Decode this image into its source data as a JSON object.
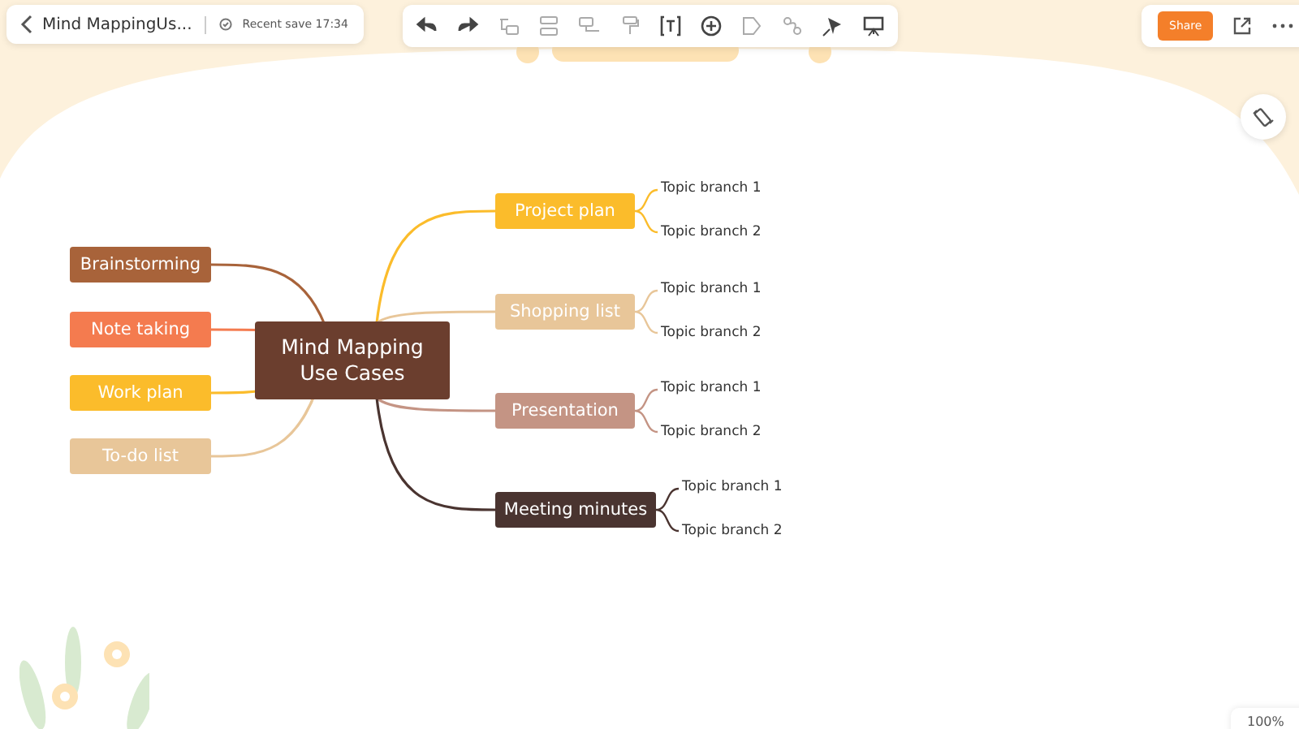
{
  "header": {
    "title": "Mind MappingUs...",
    "save_status": "Recent save 17:34",
    "share_button": "Share"
  },
  "toolbar": [
    {
      "kind": "undo",
      "disabled": false
    },
    {
      "kind": "redo",
      "disabled": false
    },
    {
      "kind": "subtopic",
      "disabled": true
    },
    {
      "kind": "sibling",
      "disabled": true
    },
    {
      "kind": "parent",
      "disabled": true
    },
    {
      "kind": "painter",
      "disabled": true
    },
    {
      "kind": "text",
      "disabled": false
    },
    {
      "kind": "insert",
      "disabled": false
    },
    {
      "kind": "shape",
      "disabled": true
    },
    {
      "kind": "relation",
      "disabled": true
    },
    {
      "kind": "style",
      "disabled": false
    },
    {
      "kind": "present",
      "disabled": false
    }
  ],
  "mind_map": {
    "central_topic": "Mind Mapping Use Cases",
    "left_topics": [
      {
        "label": "Brainstorming",
        "color": "#a8633a"
      },
      {
        "label": "Note taking",
        "color": "#f47b4f"
      },
      {
        "label": "Work plan",
        "color": "#fbbc2b"
      },
      {
        "label": "To-do list",
        "color": "#e8c699"
      }
    ],
    "right_topics": [
      {
        "label": "Project plan",
        "color": "#fbbc2b",
        "branches": [
          "Topic branch 1",
          "Topic branch 2"
        ]
      },
      {
        "label": "Shopping list",
        "color": "#e8c699",
        "branches": [
          "Topic branch 1",
          "Topic branch 2"
        ]
      },
      {
        "label": "Presentation",
        "color": "#c49484",
        "branches": [
          "Topic branch 1",
          "Topic branch 2"
        ]
      },
      {
        "label": "Meeting minutes",
        "color": "#4a3430",
        "branches": [
          "Topic branch 1",
          "Topic branch 2"
        ]
      }
    ]
  },
  "zoom": "100%"
}
